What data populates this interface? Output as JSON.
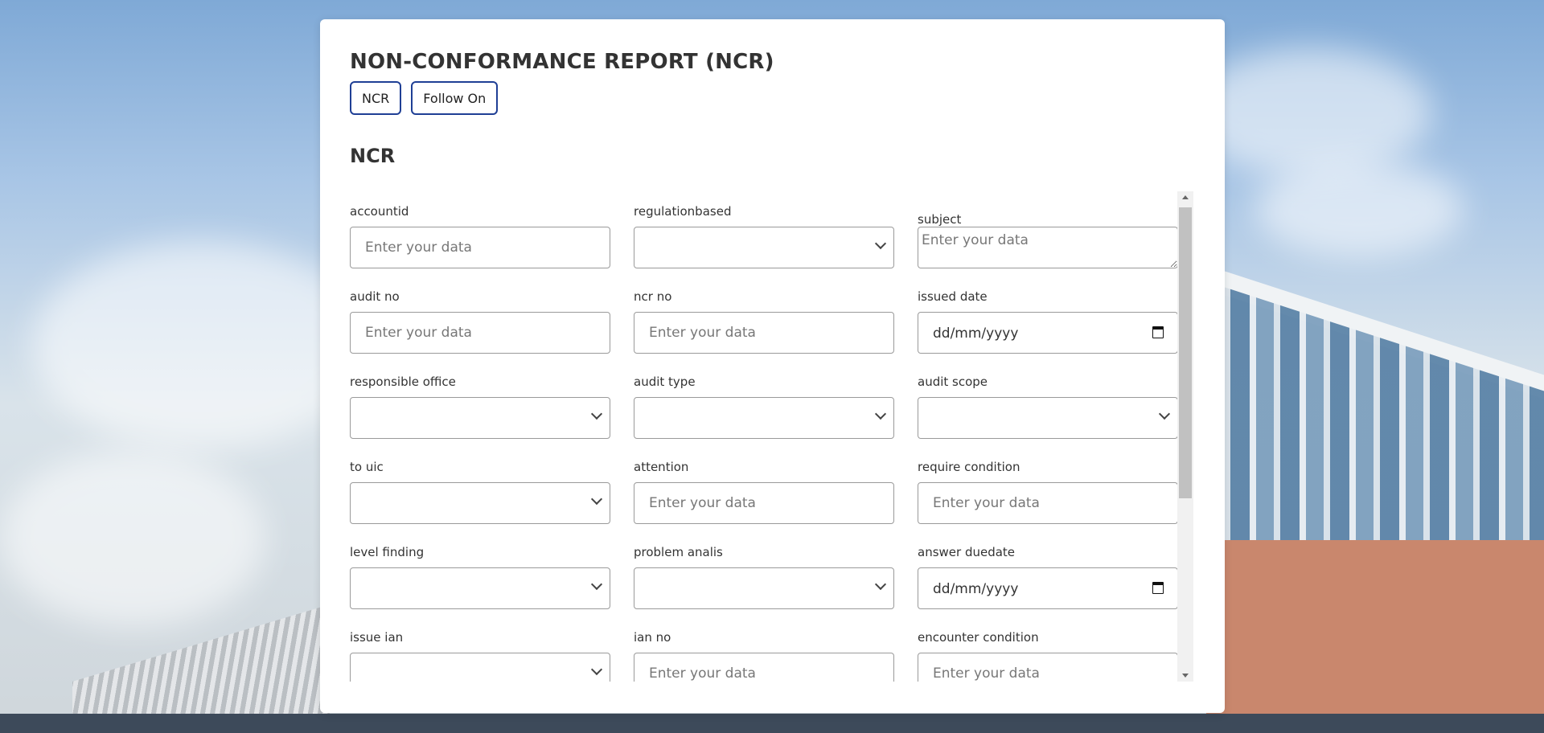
{
  "header": {
    "title": "NON-CONFORMANCE REPORT (NCR)"
  },
  "tabs": [
    {
      "label": "NCR"
    },
    {
      "label": "Follow On"
    }
  ],
  "section": {
    "title": "NCR"
  },
  "placeholder": "Enter your data",
  "date_placeholder": "dd/mm/yyyy",
  "fields": [
    {
      "label": "accountid",
      "type": "text"
    },
    {
      "label": "regulationbased",
      "type": "select"
    },
    {
      "label": "subject",
      "type": "textarea"
    },
    {
      "label": "audit no",
      "type": "text"
    },
    {
      "label": "ncr no",
      "type": "text"
    },
    {
      "label": "issued date",
      "type": "date"
    },
    {
      "label": "responsible office",
      "type": "select"
    },
    {
      "label": "audit type",
      "type": "select"
    },
    {
      "label": "audit scope",
      "type": "select"
    },
    {
      "label": "to uic",
      "type": "select"
    },
    {
      "label": "attention",
      "type": "text"
    },
    {
      "label": "require condition",
      "type": "text"
    },
    {
      "label": "level finding",
      "type": "select"
    },
    {
      "label": "problem analis",
      "type": "select"
    },
    {
      "label": "answer duedate",
      "type": "date"
    },
    {
      "label": "issue ian",
      "type": "select"
    },
    {
      "label": "ian no",
      "type": "text"
    },
    {
      "label": "encounter condition",
      "type": "text"
    }
  ]
}
